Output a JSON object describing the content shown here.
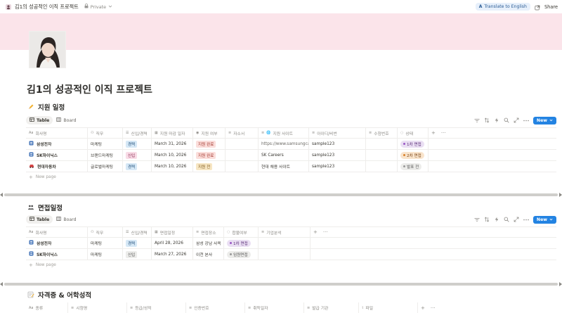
{
  "topbar": {
    "page_name": "김1의 성공적인 이직 프로젝트",
    "privacy": "Private",
    "translate": "Translate to English",
    "share": "Share"
  },
  "page": {
    "title": "김1의 성공적인 이직 프로젝트"
  },
  "sections": {
    "schedule": {
      "title": "지원 일정",
      "views": [
        "Table",
        "Board"
      ],
      "new_label": "New",
      "columns": [
        "회사명",
        "직무",
        "신입/경력",
        "지원 마감 일자",
        "지원 여부",
        "자소서",
        "지원 사이트",
        "아이디/비번",
        "수험번호",
        "상태"
      ],
      "rows": [
        {
          "company": "삼성전자",
          "role": "마케팅",
          "type": "경력",
          "deadline": "March 31, 2026",
          "applied": "지원 완료",
          "essay": "",
          "site": "https://www.samsungcareers",
          "account": "sample123",
          "exam": "",
          "status": "1차 면접"
        },
        {
          "company": "SK하이닉스",
          "role": "브랜드마케팅",
          "type": "신입",
          "deadline": "March 10, 2026",
          "applied": "지원 완료",
          "essay": "",
          "site": "SK Careers",
          "account": "sample123",
          "exam": "",
          "status": "2차 면접"
        },
        {
          "company": "현대자동차",
          "role": "글로벌마케팅",
          "type": "경력",
          "deadline": "March 10, 2026",
          "applied": "지원 전",
          "essay": "",
          "site": "현대 채용 사이트",
          "account": "sample123",
          "exam": "",
          "status": "발표 전"
        }
      ],
      "new_page": "New page"
    },
    "interview": {
      "title": "면접일정",
      "views": [
        "Table",
        "Board"
      ],
      "new_label": "New",
      "columns": [
        "회사명",
        "직무",
        "신입/경력",
        "면접일정",
        "면접장소",
        "합불여부",
        "기업분석"
      ],
      "rows": [
        {
          "company": "삼성전자",
          "role": "마케팅",
          "type": "경력",
          "date": "April 28, 2026",
          "place": "삼성 강남 사옥",
          "result": "1차 면접",
          "analysis": ""
        },
        {
          "company": "SK하이닉스",
          "role": "마케팅",
          "type": "신입",
          "date": "March 27, 2026",
          "place": "이천 본사",
          "result": "임원면접",
          "analysis": ""
        }
      ],
      "new_page": "New page"
    },
    "certs": {
      "title": "자격증 & 어학성적",
      "columns": [
        "종류",
        "시험명",
        "등급/성적",
        "인증번호",
        "취득일자",
        "발급 기관",
        "파일"
      ]
    }
  },
  "colors": {
    "cover": "#fbe4ea",
    "accent": "#2383e2"
  }
}
